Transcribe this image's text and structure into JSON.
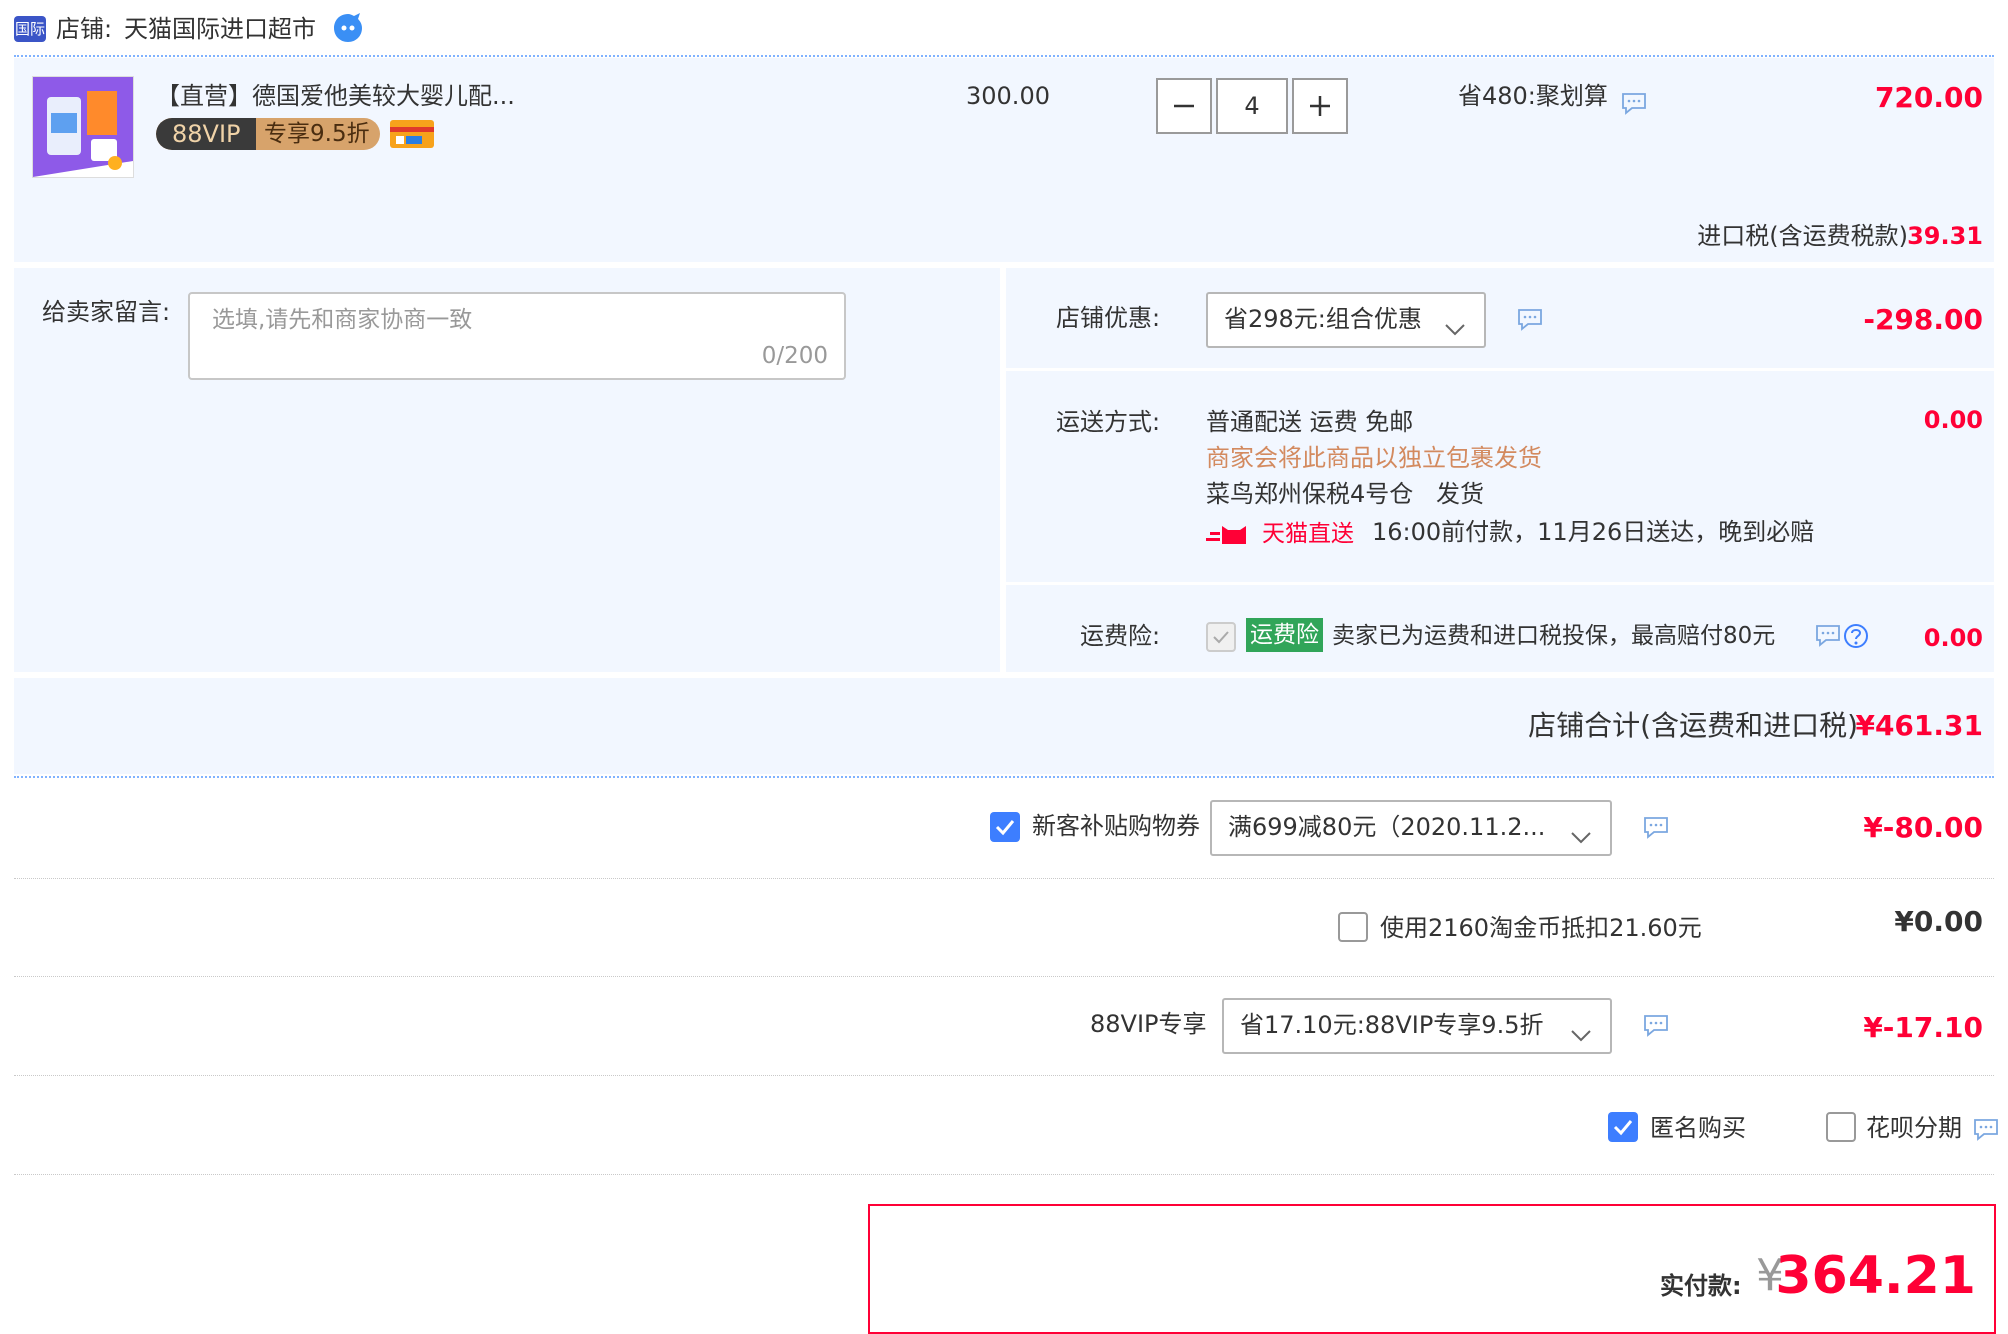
{
  "shop": {
    "badge": "国际",
    "label": "店铺:",
    "name": "天猫国际进口超市"
  },
  "item": {
    "title": "【直营】德国爱他美较大婴儿配...",
    "vip_badge": "88VIP",
    "vip_discount": "专享9.5折",
    "unit_price": "300.00",
    "quantity": "4",
    "promo": "省480:聚划算",
    "total": "720.00",
    "tax_label": "进口税(含运费税款)",
    "tax_value": "39.31"
  },
  "message": {
    "label": "给卖家留言:",
    "placeholder": "选填,请先和商家协商一致",
    "counter": "0/200"
  },
  "shop_discount": {
    "label": "店铺优惠:",
    "selected": "省298元:组合优惠",
    "amount": "-298.00"
  },
  "shipping": {
    "label": "运送方式:",
    "method": "普通配送 运费 免邮",
    "notice": "商家会将此商品以独立包裹发货",
    "warehouse": "菜鸟郑州保税4号仓",
    "ship_word": "发货",
    "direct_label": "天猫直送",
    "delivery": "16:00前付款，11月26日送达，晚到必赔",
    "amount": "0.00"
  },
  "insurance": {
    "label": "运费险:",
    "tag": "运费险",
    "desc": "卖家已为运费和进口税投保，最高赔付80元",
    "amount": "0.00"
  },
  "shop_total": {
    "label": "店铺合计(含运费和进口税)",
    "value": "¥461.31"
  },
  "coupon": {
    "label": "新客补贴购物券",
    "selected": "满699减80元（2020.11.2...",
    "amount": "¥-80.00"
  },
  "coins": {
    "label": "使用2160淘金币抵扣21.60元",
    "amount": "¥0.00"
  },
  "vip": {
    "label": "88VIP专享",
    "selected": "省17.10元:88VIP专享9.5折",
    "amount": "¥-17.10"
  },
  "options": {
    "anonymous": "匿名购买",
    "installment": "花呗分期"
  },
  "pay": {
    "label": "实付款:",
    "currency": "¥",
    "amount": "364.21"
  },
  "colors": {
    "accent_red": "#ff0036",
    "check_blue": "#3d7eff",
    "panel_bg": "#f2f7ff",
    "notice_orange": "#d38a5f",
    "insurance_green": "#31a559"
  }
}
